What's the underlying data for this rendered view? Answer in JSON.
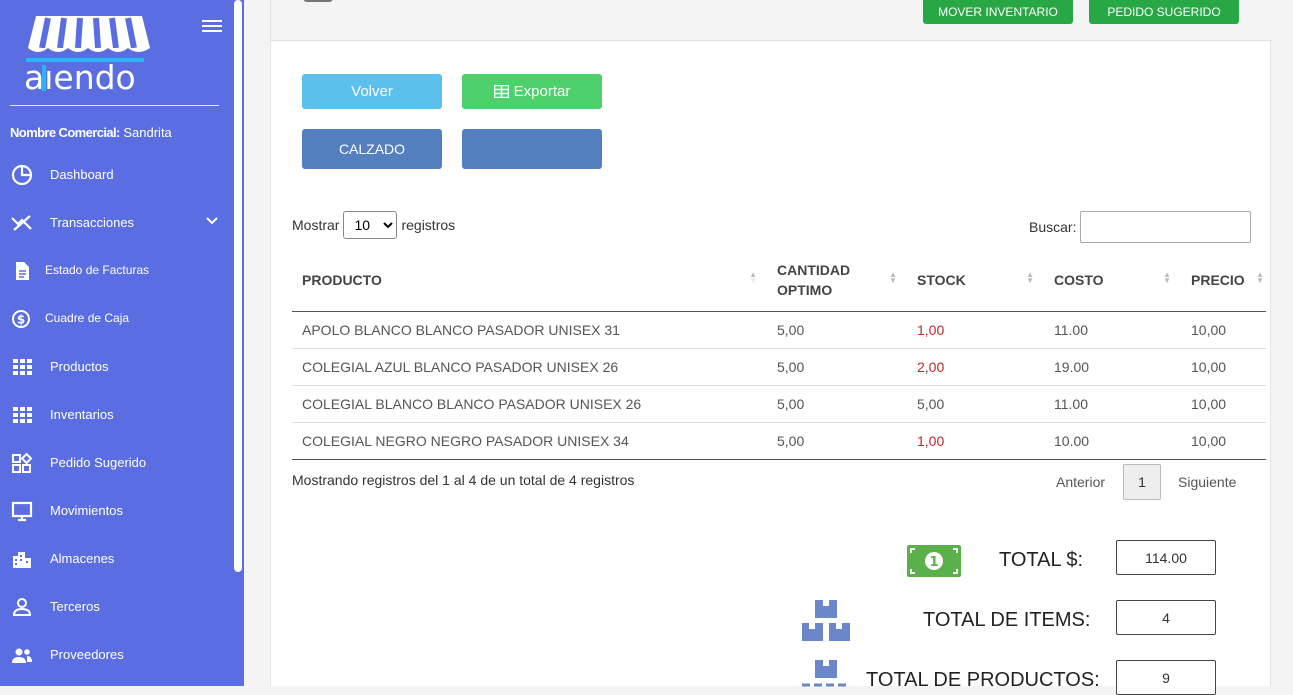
{
  "sidebar": {
    "commercial_label": "Nombre Comercial:",
    "commercial_value": "Sandrita",
    "items": [
      {
        "label": "Dashboard",
        "icon": "pie-chart-icon"
      },
      {
        "label": "Transacciones",
        "icon": "transactions-icon"
      },
      {
        "label": "Estado de Facturas",
        "icon": "document-icon"
      },
      {
        "label": "Cuadre de Caja",
        "icon": "dollar-circle-icon"
      },
      {
        "label": "Productos",
        "icon": "grid-icon"
      },
      {
        "label": "Inventarios",
        "icon": "grid-icon"
      },
      {
        "label": "Pedido Sugerido",
        "icon": "widgets-icon"
      },
      {
        "label": "Movimientos",
        "icon": "monitor-icon"
      },
      {
        "label": "Almacenes",
        "icon": "building-icon"
      },
      {
        "label": "Terceros",
        "icon": "person-icon"
      },
      {
        "label": "Proveedores",
        "icon": "people-icon"
      }
    ]
  },
  "topbar": {
    "move_inventory": "MOVER INVENTARIO",
    "suggested_order": "PEDIDO SUGERIDO"
  },
  "actions": {
    "back": "Volver",
    "export": "Exportar",
    "category": "CALZADO",
    "blank": ""
  },
  "table_controls": {
    "show_prefix": "Mostrar",
    "show_value": "10",
    "show_suffix": "registros",
    "search_label": "Buscar:"
  },
  "table": {
    "headers": [
      "PRODUCTO",
      "CANTIDAD OPTIMO",
      "STOCK",
      "COSTO",
      "PRECIO"
    ],
    "rows": [
      [
        "APOLO BLANCO BLANCO PASADOR UNISEX 31",
        "5,00",
        "1,00",
        "11.00",
        "10,00"
      ],
      [
        "COLEGIAL AZUL BLANCO PASADOR UNISEX 26",
        "5,00",
        "2,00",
        "19.00",
        "10,00"
      ],
      [
        "COLEGIAL BLANCO BLANCO PASADOR UNISEX 26",
        "5,00",
        "5,00",
        "11.00",
        "10,00"
      ],
      [
        "COLEGIAL NEGRO NEGRO PASADOR UNISEX 34",
        "5,00",
        "1,00",
        "10.00",
        "10,00"
      ]
    ],
    "info": "Mostrando registros del 1 al 4 de un total de 4 registros",
    "prev": "Anterior",
    "page": "1",
    "next": "Siguiente"
  },
  "totals": {
    "total_money_label": "TOTAL $:",
    "total_money_value": "114.00",
    "total_items_label": "TOTAL DE ITEMS:",
    "total_items_value": "4",
    "total_products_label": "TOTAL DE PRODUCTOS:",
    "total_products_value": "9"
  },
  "colors": {
    "sidebar": "#5b6ee1",
    "green": "#28a745",
    "stock_low": "#c0282a"
  }
}
